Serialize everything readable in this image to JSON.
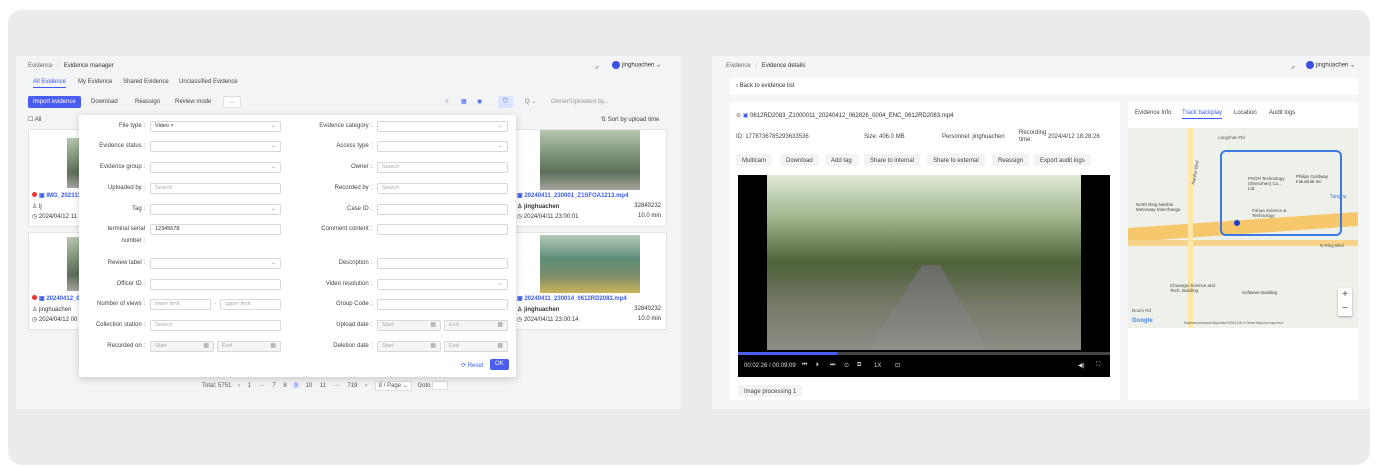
{
  "left": {
    "breadcrumb": [
      "Evidence",
      "/",
      "Evidence manager"
    ],
    "user": "jinghuachen",
    "tabs": [
      "All Evidence",
      "My Evidence",
      "Shared Evidence",
      "Unclassified Evidence"
    ],
    "toolbar": {
      "import": "Import evidence",
      "download": "Download",
      "reassign": "Reassign",
      "review": "Review mode",
      "more": "···"
    },
    "search_placeholder": "Owner/Uploaded by...",
    "search_scope": "Q ⌄",
    "all": "All",
    "sort": "Sort by upload time",
    "cards": [
      {
        "title": "IMG_202311",
        "owner": "lj",
        "time": "2024/04/12 11"
      },
      {
        "title": "20240412_0",
        "owner": "jinghuachen",
        "time": "2024/04/12 00"
      },
      {
        "title": "20240411_230001_Z1SFOA1213.mp4",
        "owner": "jinghuachen",
        "time": "2024/04/11 23:00:01",
        "size": "32840232",
        "dur": "10.0 min"
      },
      {
        "title": "20240411_230014_0612RD2083.mp4",
        "owner": "jinghuachen",
        "time": "2024/04/11 23:00:14",
        "size": "32840232",
        "dur": "10.0 min"
      }
    ],
    "filter": {
      "file_type_label": "File type :",
      "file_type_value": "Video ×",
      "status_label": "Evidence status :",
      "group_label": "Evidence group :",
      "uploaded_label": "Uploaded by :",
      "uploaded_ph": "Search",
      "tag_label": "Tag :",
      "terminal_label": "terminal serial",
      "terminal_label2": "number :",
      "terminal_value": "12345678",
      "review_label": "Review label :",
      "officer_label": "Officer ID :",
      "views_label": "Number of views :",
      "lower": "lower limit",
      "upper": "upper limit",
      "station_label": "Collection station :",
      "station_ph": "Search",
      "recorded_label": "Recorded on :",
      "start": "Start",
      "end": "End",
      "category_label": "Evidence category :",
      "access_label": "Access type :",
      "owner_label": "Owner :",
      "owner_ph": "Search",
      "recorded_by_label": "Recorded by :",
      "recorded_by_ph": "Search",
      "case_label": "Case ID :",
      "comment_label": "Comment content :",
      "desc_label": "Description :",
      "res_label": "Video resolution :",
      "groupcode_label": "Group Code :",
      "upload_label": "Upload date :",
      "deletion_label": "Deletion date :",
      "reset": "⟳ Reset",
      "ok": "OK"
    },
    "pager": {
      "total": "Total: 5751",
      "prev": "‹",
      "pages": [
        "1",
        "···",
        "7",
        "8",
        "9",
        "10",
        "11",
        "···",
        "719"
      ],
      "active": "9",
      "next": "›",
      "per_page": "8 / Page ⌄",
      "goto": "Goto"
    }
  },
  "right": {
    "breadcrumb": [
      "Evidence",
      "/",
      "Evidence details"
    ],
    "user": "jinghuachen",
    "back": "‹ Back to evidence list",
    "filename": "0612RD2083_Z1000011_20240412_062826_0004_ENC_0612RD2083.mp4",
    "id": "ID: 1778736785293633536",
    "size": "Size: 406.0 MB",
    "personnel": "Personnel: jinghuachen",
    "rec_label": "Recording time:",
    "rec_value": "2024/4/12 18:28:26",
    "actions": [
      "Multicam",
      "Download",
      "Add tag",
      "Share to internal",
      "Share to external",
      "Reassign",
      "Export audit logs"
    ],
    "player": {
      "time": "00:02:26 / 00:09:09",
      "speed": "1X",
      "progress": 0.266
    },
    "image_proc": "Image processing 1",
    "side_tabs": [
      "Evidence Info",
      "Track backplay",
      "Location",
      "Audit logs"
    ],
    "map": {
      "labels": [
        "Langshan Rd",
        "Nanhai Blvd",
        "PSON Technology (Shenzhen) Co., Ltd",
        "Philips Goldway Industrial Inc",
        "North Ring Nanhai Motorway Interchange",
        "Fuhua Science & Technology",
        "N Ring Blvd",
        "Tanghu",
        "Chuangxi Science and Tech. Building",
        "Software Building",
        "Google",
        "Keyboard shortcuts  Map data ©2024  100 m  Terms  Report a map error",
        "Doom Rd"
      ]
    }
  }
}
